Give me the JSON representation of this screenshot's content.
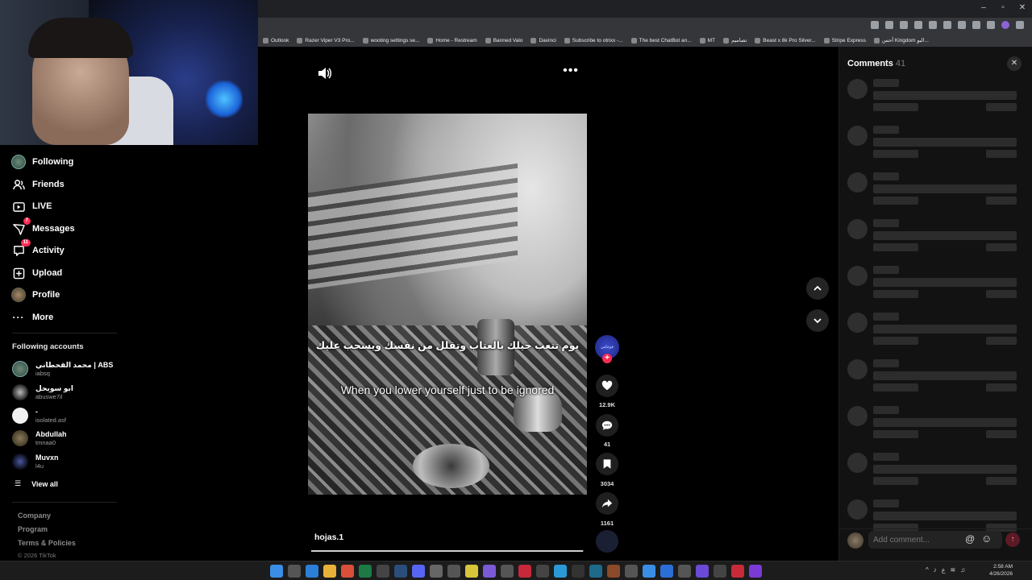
{
  "bookmarks": [
    "Outlook",
    "Razer Viper V3 Pro...",
    "wooting settings se...",
    "Home - Restream",
    "Banned Valo",
    "Davinci",
    "Subscribe to otrixx -...",
    "The best ChatBot an...",
    "MT",
    "تصاميم",
    "Beast x 8k Pro Silver...",
    "Stripe Express",
    "أحس Kingdom البو..."
  ],
  "sidebar": {
    "nav": [
      {
        "label": "Following",
        "icon": "following-avatar-icon"
      },
      {
        "label": "Friends",
        "icon": "friends-icon"
      },
      {
        "label": "LIVE",
        "icon": "live-icon"
      },
      {
        "label": "Messages",
        "icon": "messages-icon",
        "badge": "7"
      },
      {
        "label": "Activity",
        "icon": "activity-icon",
        "badge": "11"
      },
      {
        "label": "Upload",
        "icon": "upload-icon"
      },
      {
        "label": "Profile",
        "icon": "profile-avatar-icon"
      },
      {
        "label": "More",
        "icon": "more-dots-icon"
      }
    ],
    "following_title": "Following accounts",
    "accounts": [
      {
        "name": "محمد القحطاني | ABS",
        "handle": "iabsq"
      },
      {
        "name": "ابو سويحل",
        "handle": "abuswe7il"
      },
      {
        "name": "-",
        "handle": "isolated.asf"
      },
      {
        "name": "Abdullah",
        "handle": "tmnaa0"
      },
      {
        "name": "Muvxn",
        "handle": "l4u"
      }
    ],
    "view_all": "View all",
    "footer": [
      "Company",
      "Program",
      "Terms & Policies"
    ],
    "copyright": "© 2026 TikTok"
  },
  "video": {
    "caption_ar": "يوم تتعب حيلك بالعتاب وتقلل من نفسك ويسحب عليك",
    "caption_en": "When you lower yourself just to be ignored",
    "username": "hojas.1",
    "progress": 0.998,
    "likes": "12.9K",
    "comments": "41",
    "saves": "3034",
    "shares": "1161"
  },
  "comments_panel": {
    "title": "Comments",
    "count": "41",
    "placeholder": "Add comment...",
    "at_symbol": "@",
    "skeleton_rows": 10
  },
  "taskbar": {
    "time": "2:58 AM",
    "date": "4/26/2026"
  },
  "colors": {
    "accent": "#fe2c55",
    "background": "#000000",
    "panel": "#121212"
  }
}
